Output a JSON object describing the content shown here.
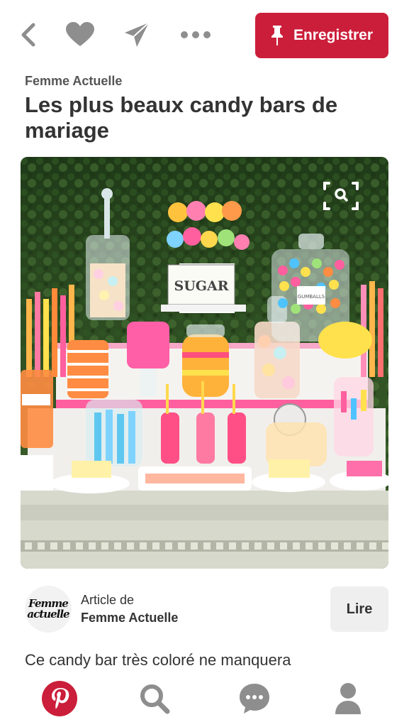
{
  "toolbar": {
    "save_label": "Enregistrer",
    "icons": [
      "back-icon",
      "heart-icon",
      "send-icon",
      "more-icon",
      "pin-icon"
    ]
  },
  "pin": {
    "source": "Femme Actuelle",
    "title": "Les plus beaux candy bars de mariage",
    "image_labels": {
      "sign": "SUGAR",
      "jar_label": "GUMBALLS"
    }
  },
  "attribution": {
    "logo_line1": "Femme",
    "logo_line2": "actuelle",
    "label": "Article de",
    "name": "Femme Actuelle",
    "read_label": "Lire"
  },
  "description": {
    "text": "Ce candy bar très coloré ne manquera"
  },
  "bottom_nav": {
    "items": [
      "pinterest-home-icon",
      "search-icon",
      "messages-icon",
      "profile-icon"
    ]
  },
  "colors": {
    "accent": "#cb1e3a",
    "icon_gray": "#8e8e8e",
    "text": "#333333"
  }
}
